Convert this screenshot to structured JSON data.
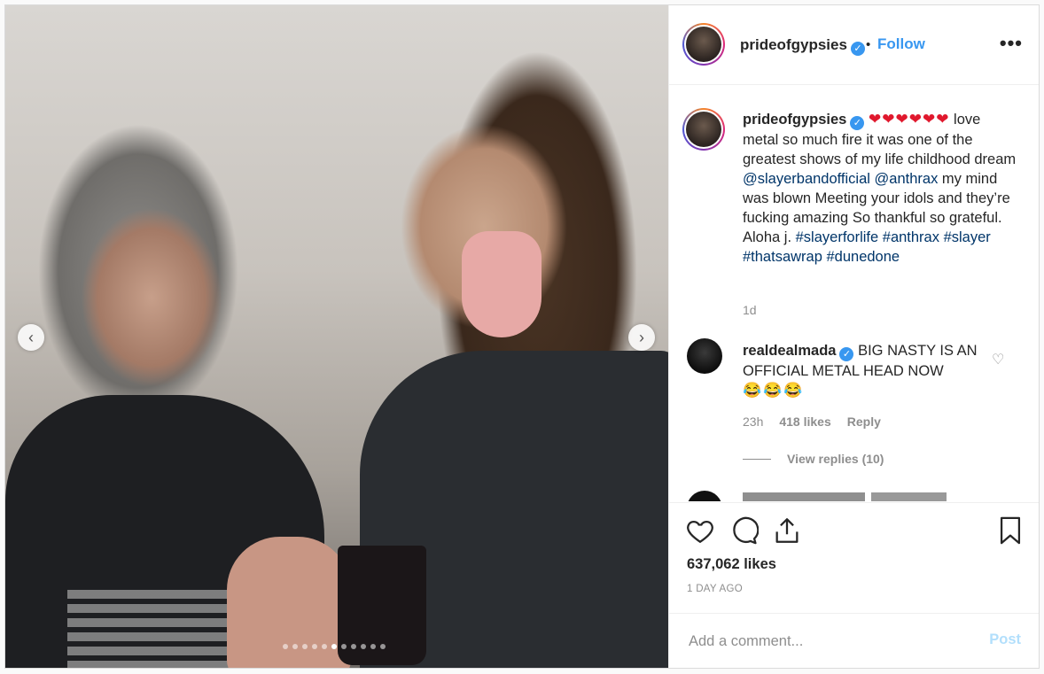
{
  "post": {
    "carousel": {
      "slide_count": 11,
      "active_index": 5
    },
    "header": {
      "username": "prideofgypsies",
      "separator": "•",
      "follow_label": "Follow",
      "more_label": "•••"
    },
    "caption": {
      "username": "prideofgypsies",
      "hearts": "❤❤❤❤❤❤",
      "text_1": "love metal so much fire it was one of the greatest shows of my life childhood dream ",
      "mention_1": "@slayerbandofficial",
      "mention_2": "@anthrax",
      "text_2": " my mind was blown Meeting your idols and they’re fucking amazing So thankful so grateful. Aloha j. ",
      "hashtag_1": "#slayerforlife",
      "hashtag_2": "#anthrax",
      "hashtag_3": "#slayer",
      "hashtag_4": "#thatsawrap",
      "hashtag_5": "#dunedone",
      "age": "1d"
    },
    "comments": [
      {
        "username": "realdealmada",
        "text": "BIG NASTY IS AN OFFICIAL METAL HEAD NOW",
        "emoji": "😂😂😂",
        "age": "23h",
        "likes": "418 likes",
        "reply_label": "Reply",
        "view_replies": "View replies (10)"
      }
    ],
    "likes_count": "637,062 likes",
    "time_ago": "1 DAY AGO",
    "add_comment": {
      "placeholder": "Add a comment...",
      "post_label": "Post"
    }
  },
  "colors": {
    "accent": "#3897f0",
    "link": "#003569",
    "muted": "#8e8e8e",
    "post_disabled": "#b2dffc",
    "heart": "#e0182d"
  }
}
